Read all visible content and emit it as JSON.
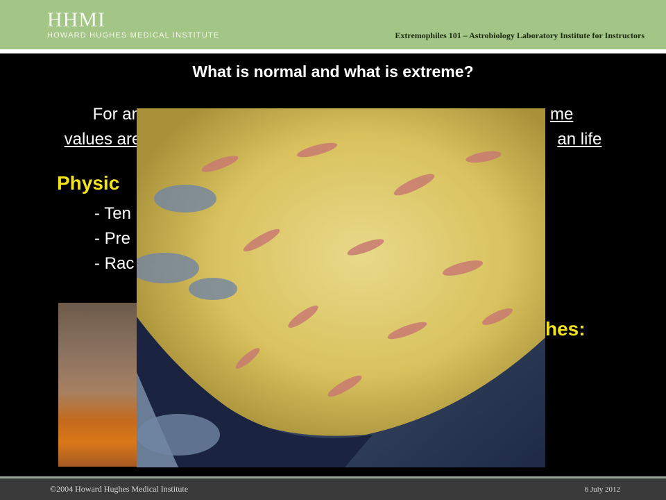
{
  "header": {
    "logo": "HHMI",
    "institute": "HOWARD HUGHES MEDICAL INSTITUTE",
    "course": "Extremophiles 101 – Astrobiology Laboratory Institute for Instructors"
  },
  "slide": {
    "title": "What is normal and what is extreme?",
    "intro_line1": "For an",
    "intro_line1_end": "me",
    "intro_line2": "values are",
    "intro_line2_end": "an life",
    "physical_heading": "Physic",
    "bullets": [
      "- Ten",
      "- Pre",
      "- Rac"
    ],
    "second_heading_partial": "hes:"
  },
  "footer": {
    "copyright": "©2004 Howard Hughes Medical Institute",
    "date": "6 July 2012"
  },
  "colors": {
    "header_bg": "#a3c585",
    "heading_yellow": "#f2e21c",
    "background": "#000000"
  }
}
